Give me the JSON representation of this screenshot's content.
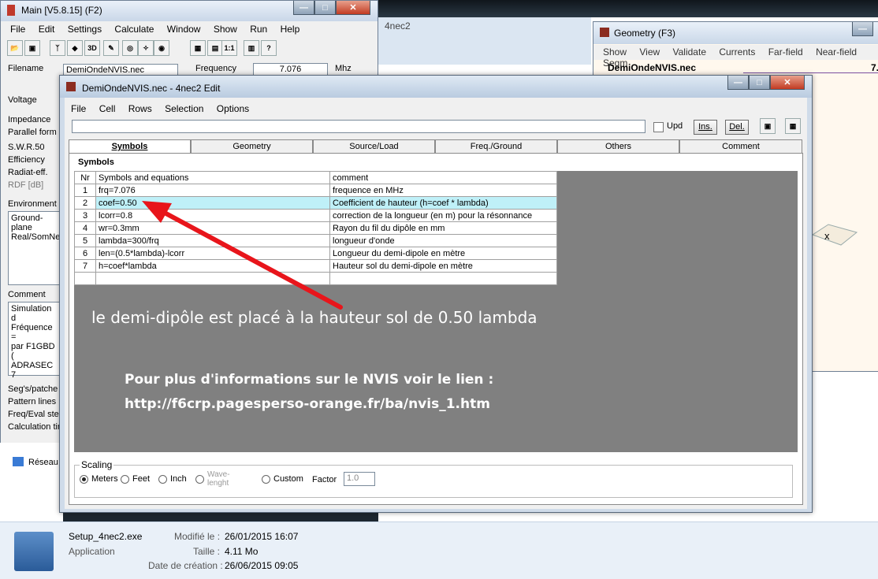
{
  "desktop": {
    "bg_title": "4nec2"
  },
  "main_window": {
    "title": "Main [V5.8.15]   (F2)",
    "menu": [
      "File",
      "Edit",
      "Settings",
      "Calculate",
      "Window",
      "Show",
      "Run",
      "Help"
    ],
    "filename_label": "Filename",
    "filename_value": "DemiOndeNVIS.nec",
    "frequency_label": "Frequency",
    "frequency_value": "7.076",
    "frequency_unit": "Mhz",
    "left_labels": [
      "Voltage",
      "Impedance",
      "Parallel form",
      "S.W.R.50",
      "Efficiency",
      "Radiat-eff.",
      "RDF [dB]",
      "Environment"
    ],
    "environment_lines": [
      "Ground-plane",
      "Real/SomNe"
    ],
    "comment_label": "Comment",
    "comment_lines": [
      "Simulation d",
      "Fréquence =",
      "par F1GBD (",
      "ADRASEC 7"
    ],
    "bottom_labels": [
      "Seg's/patche",
      "Pattern lines",
      "Freq/Eval ste",
      "Calculation tin"
    ]
  },
  "geometry_window": {
    "title": "Geometry   (F3)",
    "menu": [
      "Show",
      "View",
      "Validate",
      "Currents",
      "Far-field",
      "Near-field",
      "Segm"
    ],
    "filename": "DemiOndeNVIS.nec",
    "value": "7."
  },
  "edit_window": {
    "title": "DemiOndeNVIS.nec - 4nec2 Edit",
    "menu": [
      "File",
      "Cell",
      "Rows",
      "Selection",
      "Options"
    ],
    "upd_label": "Upd",
    "ins_label": "Ins.",
    "del_label": "Del.",
    "tabs": [
      "Symbols",
      "Geometry",
      "Source/Load",
      "Freq./Ground",
      "Others",
      "Comment"
    ],
    "section_title": "Symbols",
    "columns": [
      "Nr",
      "Symbols and equations",
      "comment"
    ],
    "rows": [
      {
        "nr": "1",
        "eq": "frq=7.076",
        "comment": "frequence en MHz"
      },
      {
        "nr": "2",
        "eq": "coef=0.50",
        "comment": "Coefficient de hauteur (h=coef * lambda)"
      },
      {
        "nr": "3",
        "eq": "lcorr=0.8",
        "comment": "correction de la longueur (en m) pour la résonnance"
      },
      {
        "nr": "4",
        "eq": "wr=0.3mm",
        "comment": "Rayon du fil du dipôle en mm"
      },
      {
        "nr": "5",
        "eq": "lambda=300/frq",
        "comment": "longueur d'onde"
      },
      {
        "nr": "6",
        "eq": "len=(0.5*lambda)-lcorr",
        "comment": "Longueur du demi-dipole en mètre"
      },
      {
        "nr": "7",
        "eq": "h=coef*lambda",
        "comment": "Hauteur sol du demi-dipole en mètre"
      },
      {
        "nr": "",
        "eq": "",
        "comment": ""
      }
    ],
    "selected_row": 2,
    "annotation": "le demi-dipôle est placé à la hauteur sol de 0.50 lambda",
    "info_line1": "Pour plus d'informations sur le NVIS voir le lien :",
    "info_line2": "http://f6crp.pagesperso-orange.fr/ba/nvis_1.htm",
    "scaling": {
      "title": "Scaling",
      "options": [
        "Meters",
        "Feet",
        "Inch",
        "Wave-\nlenght",
        "Custom"
      ],
      "selected": "Meters",
      "factor_label": "Factor",
      "factor_value": "1.0"
    },
    "arrow_color": "#e8151b"
  },
  "file_details": {
    "name": "Setup_4nec2.exe",
    "type": "Application",
    "modified_label": "Modifié le :",
    "modified_value": "26/01/2015 16:07",
    "size_label": "Taille :",
    "size_value": "4.11 Mo",
    "created_label": "Date de création :",
    "created_value": "26/06/2015 09:05"
  },
  "explorer": {
    "network_label": "Réseau"
  }
}
